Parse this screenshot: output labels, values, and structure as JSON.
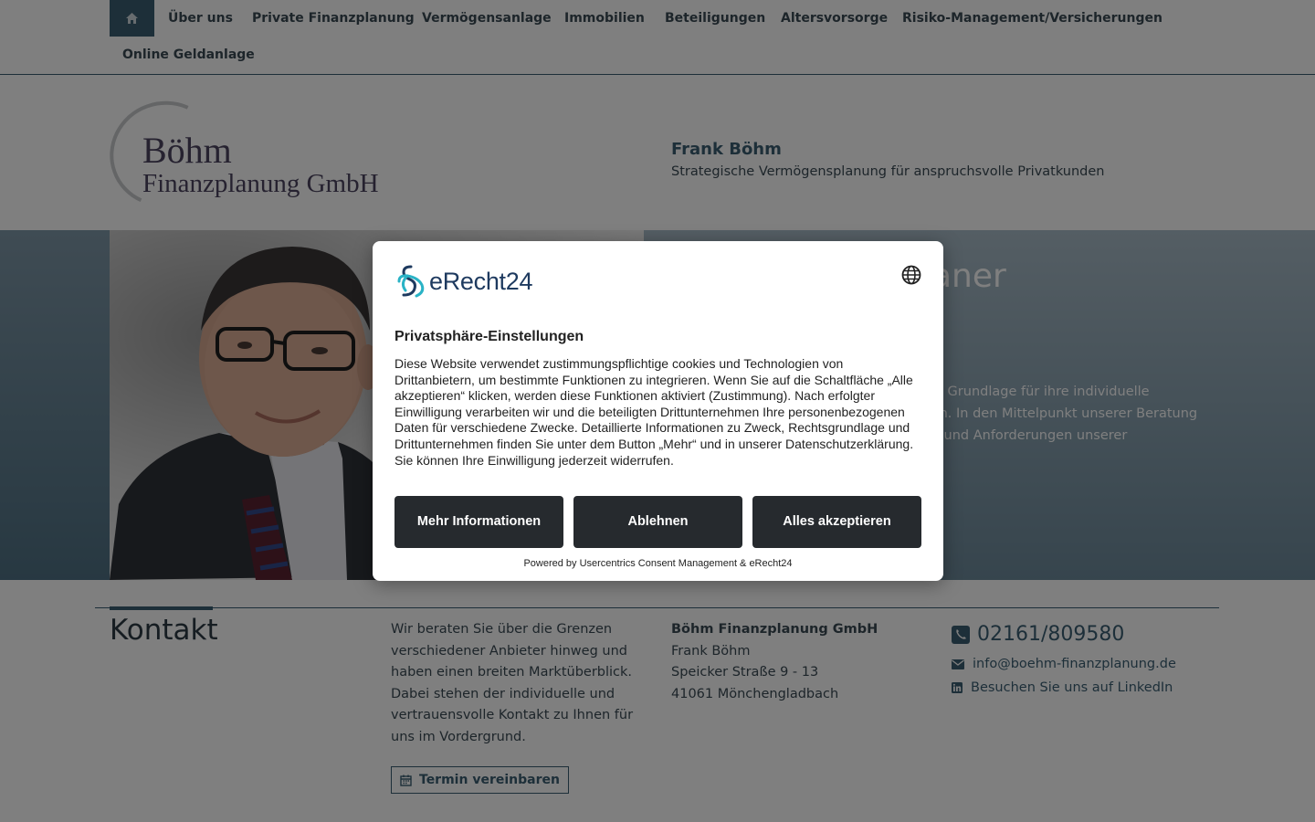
{
  "nav": {
    "home_icon": "home-icon",
    "items": [
      "Über uns",
      "Private Finanzplanung",
      "Vermögensanlage",
      "Immobilien",
      "Beteiligungen",
      "Altersvorsorge",
      "Risiko-Management/Versicherungen",
      "Online Geldanlage"
    ]
  },
  "header": {
    "logo_line1": "Böhm",
    "logo_line2": "Finanzplanung GmbH",
    "owner_name": "Frank Böhm",
    "tagline": "Strategische Vermögensplanung für anspruchsvolle Privatkunden"
  },
  "hero": {
    "title_fragment": "aner",
    "text_fragment": "ie Grundlage für ihre individuelle\nten. In den Mittelpunkt unserer Beratung\ne und Anforderungen unserer"
  },
  "contact": {
    "title": "Kontakt",
    "about": "Wir beraten Sie über die Grenzen verschiedener Anbieter hinweg und haben einen breiten Marktüberblick. Dabei stehen der individuelle und vertrauensvolle Kontakt zu Ihnen für uns im Vordergrund.",
    "appointment_button": "Termin vereinbaren",
    "company": "Böhm Finanzplanung GmbH",
    "person": "Frank Böhm",
    "street": "Speicker Straße 9 - 13",
    "city": "41061 Mönchengladbach",
    "phone": "02161/809580",
    "email": "info@boehm-finanzplanung.de",
    "linkedin": "Besuchen Sie uns auf LinkedIn"
  },
  "consent": {
    "brand": "eRecht24",
    "title": "Privatsphäre-Einstellungen",
    "body": "Diese Website verwendet zustimmungspflichtige cookies und Technologien von Drittanbietern, um bestimmte Funktionen zu integrieren. Wenn Sie auf die Schaltfläche „Alle akzeptieren“ klicken, werden diese Funktionen aktiviert (Zustimmung). Nach erfolgter Einwilligung verarbeiten wir und die beteiligten Drittunternehmen Ihre personenbezogenen Daten für verschiedene Zwecke. Detaillierte Informationen zu Zweck, Rechtsgrundlage und Drittunternehmen finden Sie unter dem Button „Mehr“ und in unserer Datenschutzerklärung. Sie können Ihre Einwilligung jederzeit widerrufen.",
    "btn_more": "Mehr Informationen",
    "btn_deny": "Ablehnen",
    "btn_accept": "Alles akzeptieren",
    "powered": "Powered by Usercentrics Consent Management & eRecht24"
  },
  "colors": {
    "primary": "#3b5f73",
    "button_dark": "#262a2e",
    "brand_blue": "#1e3a5f"
  }
}
